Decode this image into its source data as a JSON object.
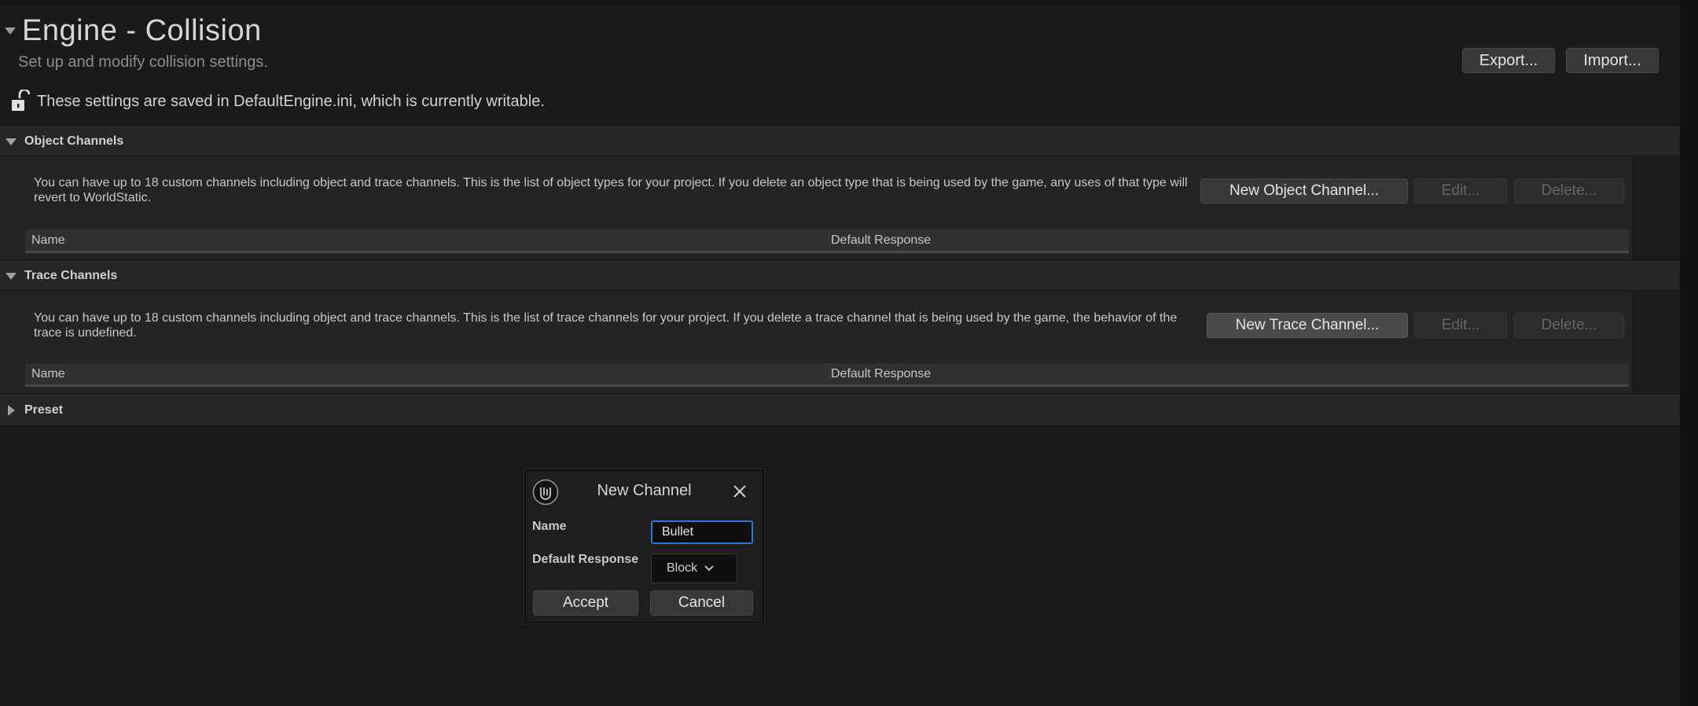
{
  "page": {
    "title": "Engine - Collision",
    "subtitle": "Set up and modify collision settings.",
    "export_label": "Export...",
    "import_label": "Import...",
    "save_notice": "These settings are saved in DefaultEngine.ini, which is currently writable."
  },
  "object_channels": {
    "title": "Object Channels",
    "description": "You can have up to 18 custom channels including object and trace channels. This is the list of object types for your project. If you delete an object type that is being used by the game, any uses of that type will revert to WorldStatic.",
    "new_label": "New Object Channel...",
    "edit_label": "Edit...",
    "delete_label": "Delete...",
    "columns": [
      "Name",
      "Default Response"
    ]
  },
  "trace_channels": {
    "title": "Trace Channels",
    "description": "You can have up to 18 custom channels including object and trace channels. This is the list of trace channels for your project. If you delete a trace channel that is being used by the game, the behavior of the trace is undefined.",
    "new_label": "New Trace Channel...",
    "edit_label": "Edit...",
    "delete_label": "Delete...",
    "columns": [
      "Name",
      "Default Response"
    ]
  },
  "preset": {
    "title": "Preset"
  },
  "dialog": {
    "title": "New Channel",
    "name_label": "Name",
    "name_value": "Bullet",
    "default_response_label": "Default Response",
    "default_response_value": "Block",
    "accept_label": "Accept",
    "cancel_label": "Cancel"
  },
  "colors": {
    "background": "#1a1a1a",
    "section_header": "#262626",
    "button": "#383838",
    "focus_accent": "#2a78d0"
  },
  "icons": [
    "collapse-arrow-icon",
    "unlock-icon",
    "unreal-logo-icon",
    "close-icon",
    "chevron-down-icon"
  ]
}
